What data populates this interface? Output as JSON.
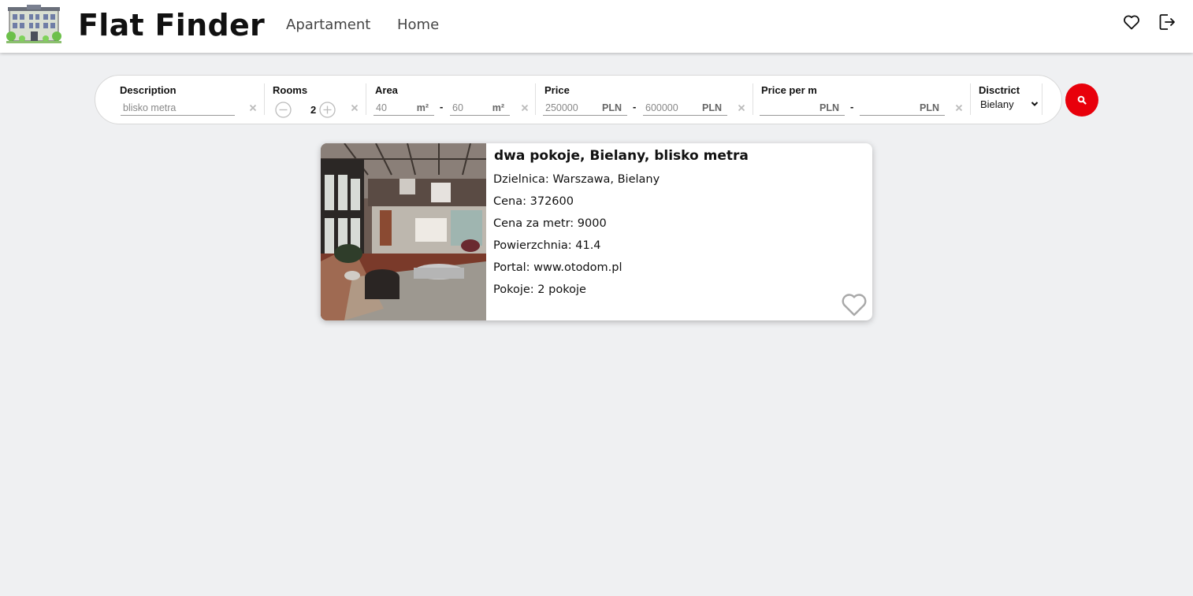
{
  "header": {
    "title": "Flat Finder",
    "nav": [
      "Apartament",
      "Home"
    ]
  },
  "search": {
    "description": {
      "label": "Description",
      "value": "blisko metra"
    },
    "rooms": {
      "label": "Rooms",
      "value": "2"
    },
    "area": {
      "label": "Area",
      "min": "40",
      "max": "60",
      "unit": "m²"
    },
    "price": {
      "label": "Price",
      "min": "250000",
      "max": "600000",
      "unit": "PLN"
    },
    "price_per_m": {
      "label": "Price per m",
      "min": "",
      "max": "",
      "unit": "PLN"
    },
    "district": {
      "label": "Disctrict",
      "value": "Bielany"
    },
    "range_separator": "-"
  },
  "listing": {
    "title": "dwa pokoje, Bielany, blisko metra",
    "lines": [
      "Dzielnica: Warszawa, Bielany",
      "Cena: 372600",
      "Cena za metr: 9000",
      "Powierzchnia: 41.4",
      "Portal: www.otodom.pl",
      "Pokoje: 2 pokoje"
    ]
  },
  "colors": {
    "accent": "#e8000b",
    "background": "#eff0f2"
  }
}
